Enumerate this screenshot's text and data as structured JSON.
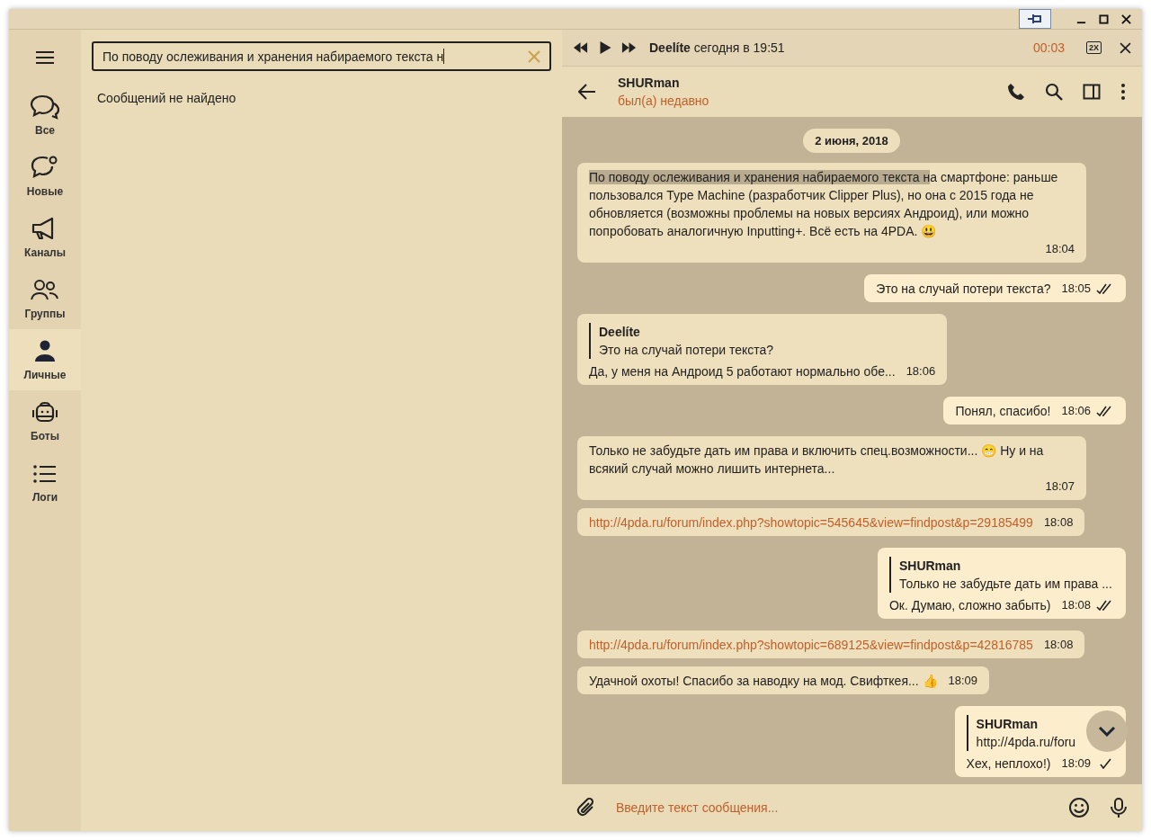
{
  "nav": {
    "items": [
      {
        "label": "Все",
        "selected": false
      },
      {
        "label": "Новые",
        "selected": false
      },
      {
        "label": "Каналы",
        "selected": false
      },
      {
        "label": "Группы",
        "selected": false
      },
      {
        "label": "Личные",
        "selected": true
      },
      {
        "label": "Боты",
        "selected": false
      },
      {
        "label": "Логи",
        "selected": false
      }
    ]
  },
  "search": {
    "value": "По поводу ослеживания и хранения набираемого текста н",
    "empty_text": "Сообщений не найдено"
  },
  "player": {
    "author": "Deelíte",
    "when": "сегодня в 19:51",
    "elapsed": "00:03",
    "speed": "2X"
  },
  "chat_header": {
    "name": "SHURman",
    "status": "был(а) недавно"
  },
  "date_label": "2 июня, 2018",
  "messages": [
    {
      "kind": "text",
      "outgoing": false,
      "highlight": "По поводу ослеживания и хранения набираемого текста н",
      "text": "а смартфоне: раньше пользовался Type Machine (разработчик Clipper Plus), но она с 2015 года не обновляется (возможны проблемы на новых версиях Андроид), или можно попробовать аналогичную Inputting+. Всё есть на 4PDA. 😃",
      "time": "18:04"
    },
    {
      "kind": "text",
      "outgoing": true,
      "read": true,
      "text": "Это на случай потери текста?",
      "time": "18:05"
    },
    {
      "kind": "reply",
      "outgoing": false,
      "quote_author": "Deelíte",
      "quote_text": "Это на случай потери текста?",
      "text": "Да, у меня на Андроид 5 работают нормально обе...",
      "time": "18:06"
    },
    {
      "kind": "text",
      "outgoing": true,
      "read": true,
      "text": "Понял, спасибо!",
      "time": "18:06"
    },
    {
      "kind": "text",
      "outgoing": false,
      "text": "Только не забудьте дать им права и включить спец.возможности... 😁 Ну и на всякий случай можно лишить интернета...",
      "time": "18:07"
    },
    {
      "kind": "link",
      "outgoing": false,
      "text": "http://4pda.ru/forum/index.php?showtopic=545645&view=findpost&p=29185499",
      "time": "18:08"
    },
    {
      "kind": "reply",
      "outgoing": true,
      "read": true,
      "quote_author": "SHURman",
      "quote_text": "Только не забудьте дать им права ...",
      "text": "Ок. Думаю, сложно забыть)",
      "time": "18:08"
    },
    {
      "kind": "link",
      "outgoing": false,
      "text": "http://4pda.ru/forum/index.php?showtopic=689125&view=findpost&p=42816785",
      "time": "18:08"
    },
    {
      "kind": "text",
      "outgoing": false,
      "text": "Удачной охоты! Спасибо за наводку на мод. Свифткея... 👍",
      "time": "18:09"
    },
    {
      "kind": "reply",
      "outgoing": true,
      "read": false,
      "quote_author": "SHURman",
      "quote_text": "http://4pda.ru/foru",
      "text": "Хех, неплохо!)",
      "time": "18:09"
    }
  ],
  "composer": {
    "placeholder": "Введите текст сообщения..."
  }
}
